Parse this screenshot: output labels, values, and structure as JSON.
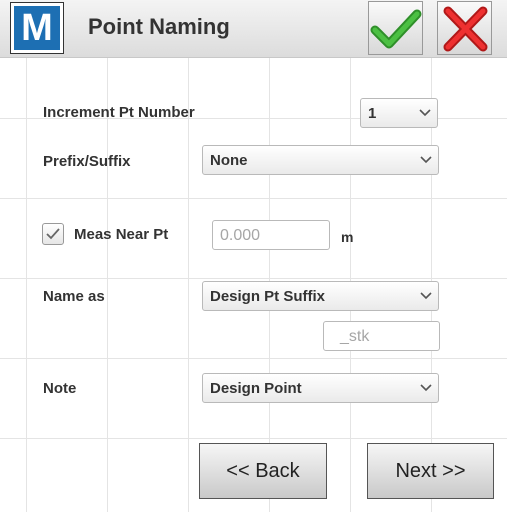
{
  "header": {
    "logo_letter": "M",
    "title": "Point Naming",
    "accept_icon": "checkmark-icon",
    "cancel_icon": "x-icon",
    "accept_color": "#3aa635",
    "cancel_color": "#e02a2a"
  },
  "form": {
    "increment": {
      "label": "Increment Pt Number",
      "value": "1"
    },
    "prefix_suffix": {
      "label": "Prefix/Suffix",
      "value": "None"
    },
    "meas_near": {
      "label": "Meas Near Pt",
      "checked": true,
      "value": "0.000",
      "unit": "m"
    },
    "name_as": {
      "label": "Name as",
      "value": "Design Pt Suffix",
      "suffix_placeholder": "_stk"
    },
    "note": {
      "label": "Note",
      "value": "Design Point"
    }
  },
  "footer": {
    "back_label": "<< Back",
    "next_label": "Next >>"
  }
}
